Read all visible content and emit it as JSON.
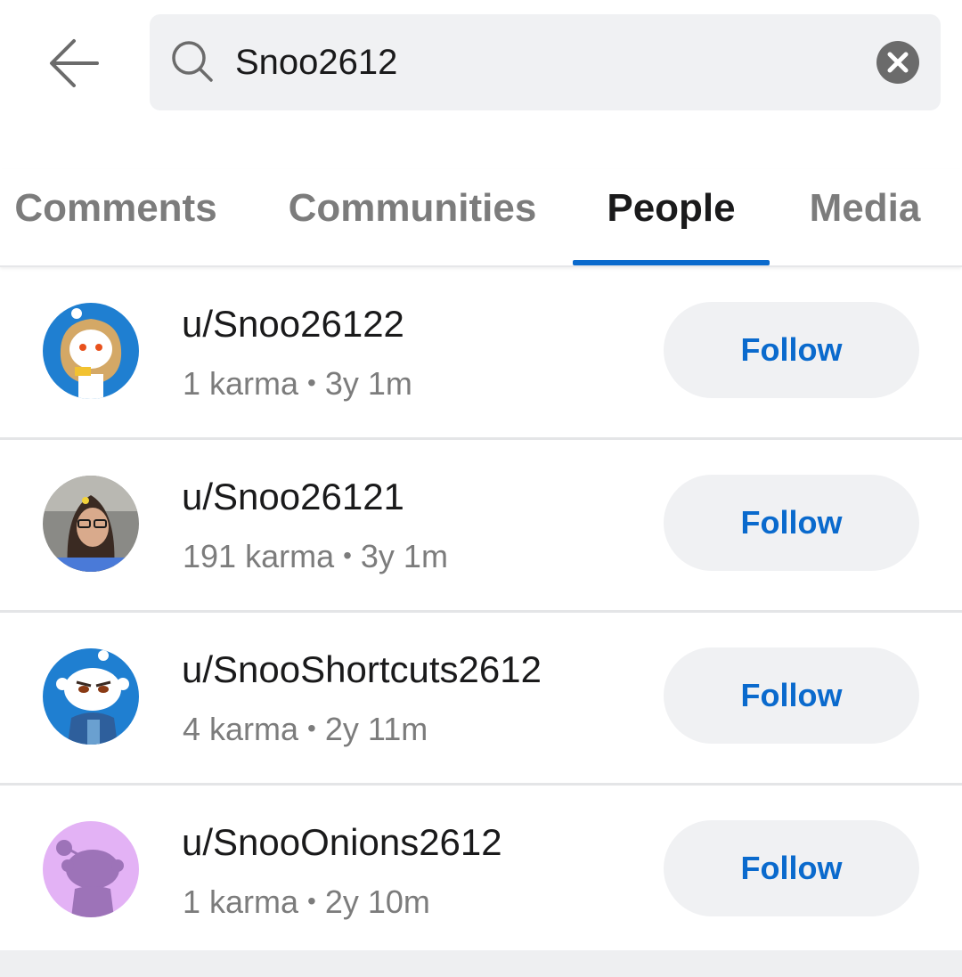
{
  "search": {
    "value": "Snoo2612"
  },
  "tabs": [
    {
      "label": "Comments",
      "active": false
    },
    {
      "label": "Communities",
      "active": false
    },
    {
      "label": "People",
      "active": true
    },
    {
      "label": "Media",
      "active": false
    }
  ],
  "people": [
    {
      "username": "u/Snoo26122",
      "karma": "1 karma",
      "age": "3y 1m",
      "follow_label": "Follow",
      "avatar": "snoo-hooded-avatar"
    },
    {
      "username": "u/Snoo26121",
      "karma": "191 karma",
      "age": "3y 1m",
      "follow_label": "Follow",
      "avatar": "photo-avatar"
    },
    {
      "username": "u/SnooShortcuts2612",
      "karma": "4 karma",
      "age": "2y 11m",
      "follow_label": "Follow",
      "avatar": "snoo-jacket-avatar"
    },
    {
      "username": "u/SnooOnions2612",
      "karma": "1 karma",
      "age": "2y 10m",
      "follow_label": "Follow",
      "avatar": "snoo-silhouette-avatar"
    }
  ],
  "colors": {
    "accent": "#0a6acd",
    "avatar_blue": "#1f7fd1",
    "avatar_purple": "#e3b2f5"
  }
}
